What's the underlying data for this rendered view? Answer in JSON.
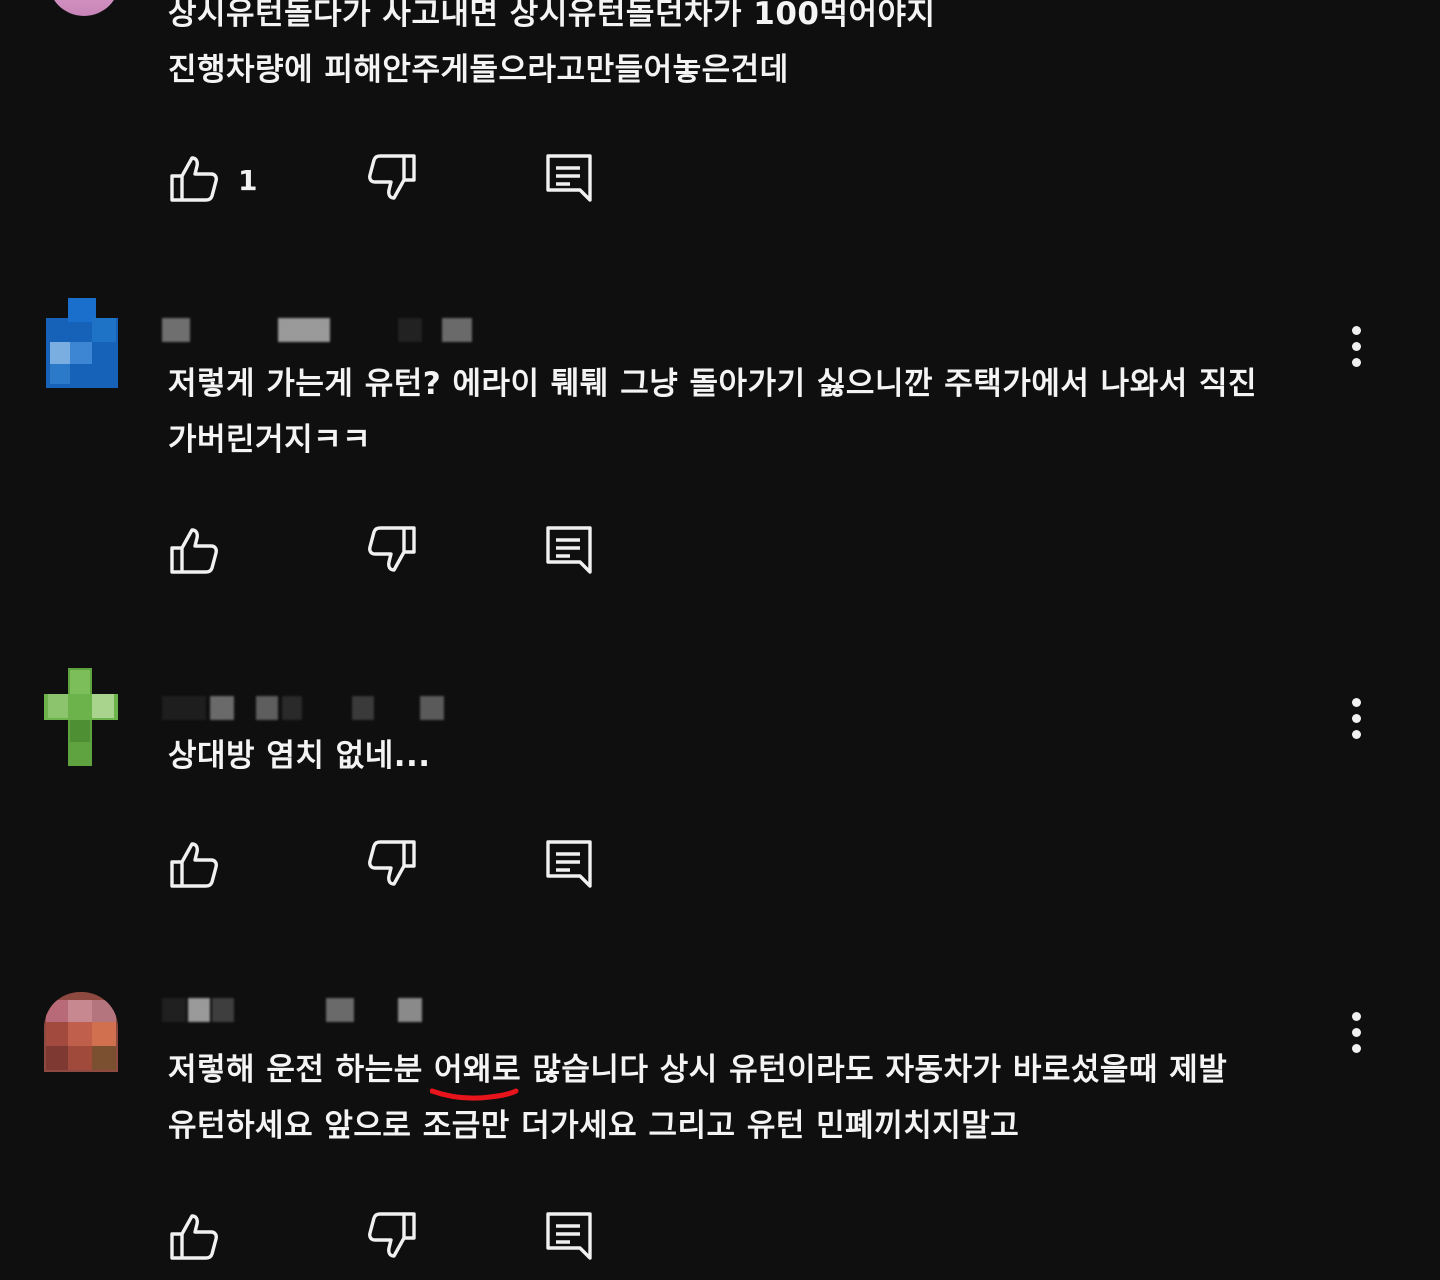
{
  "comments": [
    {
      "lines": [
        "상시유턴돌다가 사고내면 상시유턴돌던차가 100먹어야지",
        "진행차량에 피해안주게돌으라고만들어놓은건데"
      ],
      "like_count": "1",
      "avatar_color": "#d9a0c6"
    },
    {
      "lines": [
        "저렇게 가는게 유턴? 에라이 퉤퉤 그냥 돌아가기 싫으니깐 주택가에서 나와서 직진",
        "가버린거지ㅋㅋ"
      ],
      "like_count": "",
      "avatar_color": "#1d6fc4"
    },
    {
      "lines": [
        "상대방 염치 없네..."
      ],
      "like_count": "",
      "avatar_color": "#6fb44f"
    },
    {
      "lines": [
        "저렇해 운전 하는분 어왜로 많습니다 상시 유턴이라도 자동차가 바로섰을때 제발",
        "유턴하세요 앞으로 조금만 더가세요 그리고 유턴 민폐끼치지말고"
      ],
      "like_count": "",
      "avatar_color": "#a9554a"
    }
  ],
  "icons": {
    "like": "thumbs-up-icon",
    "dislike": "thumbs-down-icon",
    "reply": "reply-comment-icon",
    "more": "vertical-ellipsis-icon"
  },
  "colors": {
    "background": "#0f0f0f",
    "text": "#f1f1f1",
    "annotation_underline": "#e8141c"
  }
}
